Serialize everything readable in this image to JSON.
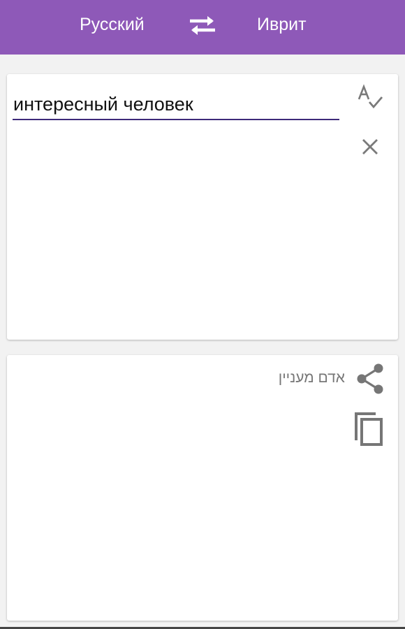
{
  "header": {
    "source_language": "Русский",
    "target_language": "Иврит",
    "swap_icon": "swap-arrows-icon",
    "background_color": "#8e59b8"
  },
  "input": {
    "value": "интересный человек",
    "underline_color": "#3d2a7a",
    "spellcheck_icon": "spellcheck-icon",
    "clear_icon": "close-icon"
  },
  "output": {
    "text": "אדם מעניין",
    "share_icon": "share-icon",
    "copy_icon": "copy-icon"
  }
}
